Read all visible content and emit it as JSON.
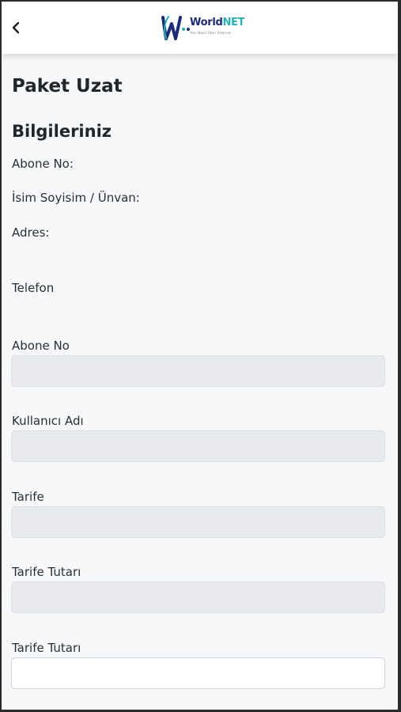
{
  "header": {
    "logo_brand_prefix": "World",
    "logo_brand_suffix": "NET",
    "logo_tagline": "Yeni Nesil Fiber İnternet",
    "back_icon": "chevron-left-icon"
  },
  "page": {
    "title": "Paket Uzat",
    "section_title": "Bilgileriniz"
  },
  "info": {
    "abone_no_label": "Abone No:",
    "isim_label": "İsim Soyisim / Ünvan:",
    "adres_label": "Adres:",
    "telefon_label": "Telefon"
  },
  "form": {
    "abone_no": {
      "label": "Abone No",
      "value": ""
    },
    "kullanici_adi": {
      "label": "Kullanıcı Adı",
      "value": ""
    },
    "tarife": {
      "label": "Tarife",
      "value": ""
    },
    "tarife_tutari": {
      "label": "Tarife Tutarı",
      "value": ""
    },
    "tarife_tutari_2": {
      "label": "Tarife Tutarı",
      "value": ""
    }
  },
  "colors": {
    "brand_navy": "#1b2b7a",
    "brand_teal": "#22b4b6",
    "readonly_field": "#e9eaed",
    "page_bg": "#f7f8fa"
  }
}
